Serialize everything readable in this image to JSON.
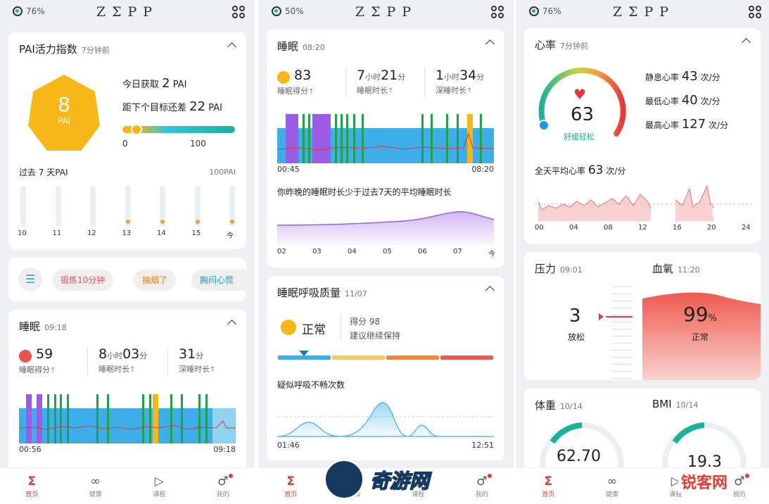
{
  "colors": {
    "accent": "#1bb29a",
    "red": "#e53935",
    "orange": "#f8b718",
    "purple": "#9b5de5",
    "blue": "#3daee9",
    "green": "#1fa24b"
  },
  "brand": "ZΣPP",
  "nav": [
    {
      "label": "首页",
      "icon": "sigma-icon"
    },
    {
      "label": "健康",
      "icon": "health-icon"
    },
    {
      "label": "课程",
      "icon": "course-icon"
    },
    {
      "label": "我的",
      "icon": "profile-icon"
    }
  ],
  "watermark": {
    "text": "奇游网"
  },
  "logo_text": "锐客网",
  "p1": {
    "battery": "76%",
    "pai": {
      "title": "PAI活力指数",
      "time": "7分钟前",
      "value": "8",
      "unit": "PAI",
      "today_label": "今日获取",
      "today_value": "2",
      "today_unit": "PAI",
      "gap_label": "距下个目标还差",
      "gap_value": "22",
      "gap_unit": "PAI",
      "bar_min": "0",
      "bar_max": "100",
      "bar_progress": 0.08,
      "week_label": "过去 7 天PAI",
      "week_max": "100PAI",
      "days": [
        "10",
        "11",
        "12",
        "13",
        "14",
        "15",
        "今"
      ],
      "day_values": [
        0,
        0,
        0,
        1,
        1,
        1,
        1
      ]
    },
    "chips": [
      "锻炼10分钟",
      "抽烟了",
      "胸闷心慌"
    ],
    "sleep": {
      "title": "睡眠",
      "time": "09:18",
      "score": "59",
      "score_label": "睡眠得分",
      "dur_h": "8",
      "dur_m": "03",
      "dur_label": "睡眠时长",
      "deep": "31",
      "deep_label": "深睡时长",
      "unit_h": "小时",
      "unit_m": "分",
      "start": "00:56",
      "end": "09:18"
    }
  },
  "p2": {
    "battery": "50%",
    "sleep": {
      "title": "睡眠",
      "time": "08:20",
      "score": "83",
      "score_label": "睡眠得分",
      "dur_h": "7",
      "dur_m": "21",
      "dur_label": "睡眠时长",
      "deep_h": "1",
      "deep_m": "34",
      "deep_label": "深睡时长",
      "unit_h": "小时",
      "unit_m": "分",
      "start": "00:45",
      "end": "08:20",
      "compare": "你昨晚的睡眠时长少于过去7天的平均睡眠时长",
      "week_days": [
        "02",
        "03",
        "04",
        "05",
        "06",
        "07",
        "今"
      ]
    },
    "breath": {
      "title": "睡眠呼吸质量",
      "time": "11/07",
      "status": "正常",
      "score_label": "得分",
      "score": "98",
      "advice": "建议继续保持",
      "count_title": "疑似呼吸不畅次数",
      "start": "01:46",
      "end": "12:51"
    }
  },
  "p3": {
    "battery": "76%",
    "hr": {
      "title": "心率",
      "time": "7分钟前",
      "value": "63",
      "status": "舒缓轻松",
      "resting_label": "静息心率",
      "resting": "43",
      "min_label": "最低心率",
      "min": "40",
      "max_label": "最高心率",
      "max": "127",
      "unit": "次/分",
      "avg_label": "全天平均心率",
      "avg": "63",
      "hours": [
        "00",
        "04",
        "08",
        "12",
        "16",
        "20",
        "24"
      ]
    },
    "stress": {
      "title": "压力",
      "time": "09:01",
      "value": "3",
      "status": "放松"
    },
    "spo2": {
      "title": "血氧",
      "time": "11:20",
      "value": "99",
      "unit": "%",
      "status": "正常"
    },
    "weight": {
      "title": "体重",
      "time": "10/14",
      "value": "62.70"
    },
    "bmi": {
      "title": "BMI",
      "time": "10/14",
      "value": "19.3"
    }
  }
}
